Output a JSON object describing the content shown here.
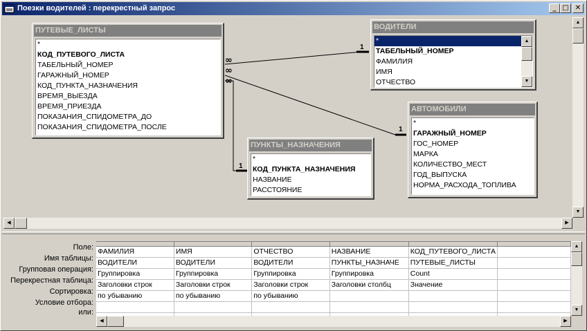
{
  "window": {
    "title": "Поезки водителей : перекрестный запрос"
  },
  "tables": {
    "putevye": {
      "name": "ПУТЕВЫЕ_ЛИСТЫ",
      "fields": [
        "*",
        "КОД_ПУТЕВОГО_ЛИСТА",
        "ТАБЕЛЬНЫЙ_НОМЕР",
        "ГАРАЖНЫЙ_НОМЕР",
        "КОД_ПУНКТА_НАЗНАЧЕНИЯ",
        "ВРЕМЯ_ВЫЕЗДА",
        "ВРЕМЯ_ПРИЕЗДА",
        "ПОКАЗАНИЯ_СПИДОМЕТРА_ДО",
        "ПОКАЗАНИЯ_СПИДОМЕТРА_ПОСЛЕ"
      ]
    },
    "voditeli": {
      "name": "ВОДИТЕЛИ",
      "fields": [
        "*",
        "ТАБЕЛЬНЫЙ_НОМЕР",
        "ФАМИЛИЯ",
        "ИМЯ",
        "ОТЧЕСТВО"
      ]
    },
    "avtomobili": {
      "name": "АВТОМОБИЛИ",
      "fields": [
        "*",
        "ГАРАЖНЫЙ_НОМЕР",
        "ГОС_НОМЕР",
        "МАРКА",
        "КОЛИЧЕСТВО_МЕСТ",
        "ГОД_ВЫПУСКА",
        "НОРМА_РАСХОДА_ТОПЛИВА"
      ]
    },
    "punkty": {
      "name": "ПУНКТЫ_НАЗНАЧЕНИЯ",
      "fields": [
        "*",
        "КОД_ПУНКТА_НАЗНАЧЕНИЯ",
        "НАЗВАНИЕ",
        "РАССТОЯНИЕ"
      ]
    }
  },
  "relations": {
    "one": "1",
    "many": "∞"
  },
  "grid": {
    "row_labels": [
      "Поле:",
      "Имя таблицы:",
      "Групповая операция:",
      "Перекрестная таблица:",
      "Сортировка:",
      "Условие отбора:",
      "или:"
    ],
    "columns": [
      [
        "ФАМИЛИЯ",
        "ВОДИТЕЛИ",
        "Группировка",
        "Заголовки строк",
        "по убыванию",
        "",
        ""
      ],
      [
        "ИМЯ",
        "ВОДИТЕЛИ",
        "Группировка",
        "Заголовки строк",
        "по убыванию",
        "",
        ""
      ],
      [
        "ОТЧЕСТВО",
        "ВОДИТЕЛИ",
        "Группировка",
        "Заголовки строк",
        "по убыванию",
        "",
        ""
      ],
      [
        "НАЗВАНИЕ",
        "ПУНКТЫ_НАЗНАЧЕ",
        "Группировка",
        "Заголовки столбц",
        "",
        "",
        ""
      ],
      [
        "КОД_ПУТЕВОГО_ЛИСТА",
        "ПУТЕВЫЕ_ЛИСТЫ",
        "Count",
        "Значение",
        "",
        "",
        ""
      ],
      [
        "",
        "",
        "",
        "",
        "",
        "",
        ""
      ]
    ]
  },
  "controls": {
    "minimize": "_",
    "maximize": "□",
    "close": "✕"
  },
  "colors": {
    "title_start": "#0a246a",
    "title_end": "#a6caf0",
    "face": "#d4d0c8"
  }
}
